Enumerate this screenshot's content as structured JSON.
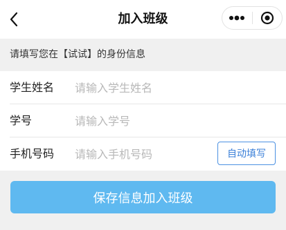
{
  "navbar": {
    "title": "加入班级",
    "back_icon": "chevron-left-icon",
    "more_icon": "more-dots-icon",
    "close_icon": "target-circle-icon"
  },
  "info": {
    "text": "请填写您在【试试】的身份信息"
  },
  "form": {
    "name": {
      "label": "学生姓名",
      "placeholder": "请输入学生姓名",
      "value": ""
    },
    "student_id": {
      "label": "学号",
      "placeholder": "请输入学号",
      "value": ""
    },
    "phone": {
      "label": "手机号码",
      "placeholder": "请输入手机号码",
      "value": "",
      "autofill_label": "自动填写"
    }
  },
  "submit": {
    "label": "保存信息加入班级"
  },
  "colors": {
    "primary": "#5fb9f0",
    "link": "#3a7fd8",
    "background": "#f0f0f0"
  }
}
